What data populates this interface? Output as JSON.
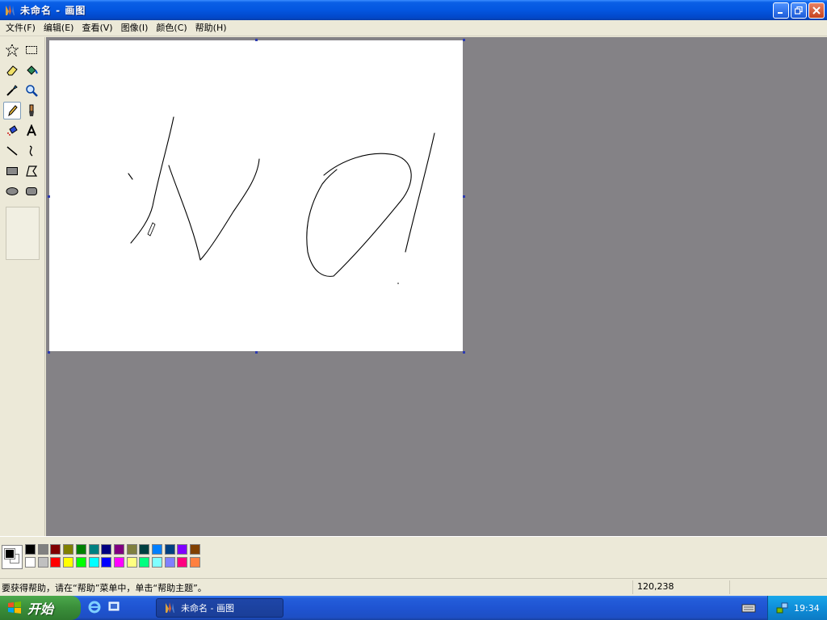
{
  "window": {
    "title": "未命名 - 画图"
  },
  "menu": {
    "items": [
      "文件(F)",
      "编辑(E)",
      "查看(V)",
      "图像(I)",
      "颜色(C)",
      "帮助(H)"
    ]
  },
  "toolbox": {
    "tools": [
      {
        "name": "free-select",
        "icon": "star-select-icon"
      },
      {
        "name": "rect-select",
        "icon": "rect-select-icon"
      },
      {
        "name": "eraser",
        "icon": "eraser-icon"
      },
      {
        "name": "fill",
        "icon": "fill-bucket-icon"
      },
      {
        "name": "pick-color",
        "icon": "eyedropper-icon"
      },
      {
        "name": "magnifier",
        "icon": "magnifier-icon"
      },
      {
        "name": "pencil",
        "icon": "pencil-icon",
        "active": true
      },
      {
        "name": "brush",
        "icon": "brush-icon"
      },
      {
        "name": "airbrush",
        "icon": "airbrush-icon"
      },
      {
        "name": "text",
        "icon": "text-icon"
      },
      {
        "name": "line",
        "icon": "line-icon"
      },
      {
        "name": "curve",
        "icon": "curve-icon"
      },
      {
        "name": "rectangle",
        "icon": "rectangle-icon"
      },
      {
        "name": "polygon",
        "icon": "polygon-icon"
      },
      {
        "name": "ellipse",
        "icon": "ellipse-icon"
      },
      {
        "name": "rounded-rectangle",
        "icon": "rounded-rect-icon"
      }
    ]
  },
  "palette": {
    "foreground": "#000000",
    "background": "#ffffff",
    "top_row": [
      "#000000",
      "#808080",
      "#800000",
      "#808000",
      "#008000",
      "#008080",
      "#000080",
      "#800080",
      "#808040",
      "#004040",
      "#0080ff",
      "#004080",
      "#8000ff",
      "#804000"
    ],
    "bottom_row": [
      "#ffffff",
      "#c0c0c0",
      "#ff0000",
      "#ffff00",
      "#00ff00",
      "#00ffff",
      "#0000ff",
      "#ff00ff",
      "#ffff80",
      "#00ff80",
      "#80ffff",
      "#8080ff",
      "#ff0080",
      "#ff8040"
    ]
  },
  "status": {
    "help_text": "要获得帮助，请在“帮助”菜单中，单击“帮助主题”。",
    "coords": "120,238"
  },
  "taskbar": {
    "start_label": "开始",
    "task_label": "未命名 - 画图",
    "clock": "19:34"
  }
}
